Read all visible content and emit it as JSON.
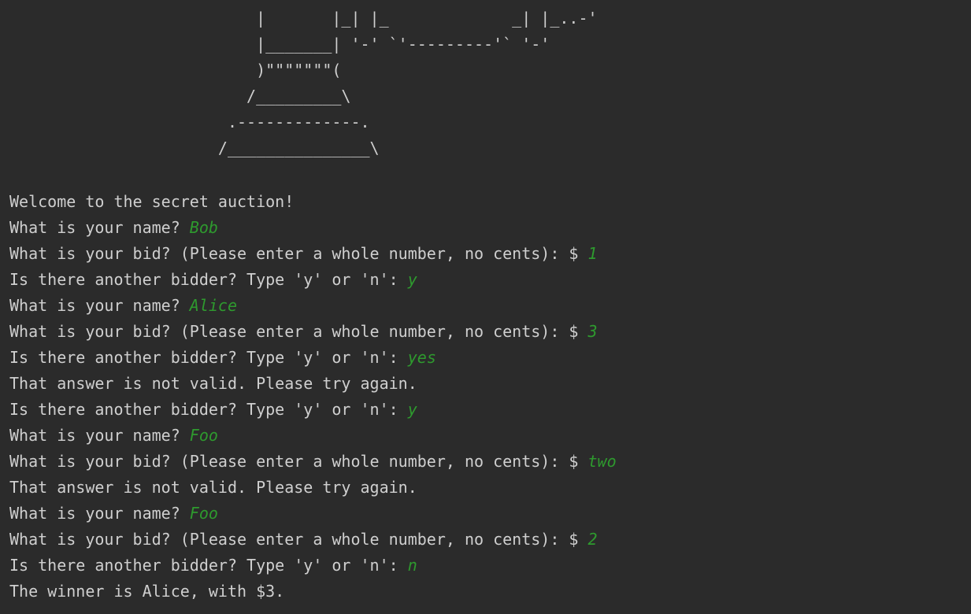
{
  "ascii_art": [
    "                          |       |_| |_             _| |_..-'",
    "                          |_______| '-' `'---------'` '-'",
    "                          )\"\"\"\"\"\"\"(",
    "                         /_________\\",
    "                       .-------------.",
    "                      /_______________\\"
  ],
  "session": [
    {
      "text": "Welcome to the secret auction!",
      "input": ""
    },
    {
      "text": "What is your name? ",
      "input": "Bob"
    },
    {
      "text": "What is your bid? (Please enter a whole number, no cents): $ ",
      "input": "1"
    },
    {
      "text": "Is there another bidder? Type 'y' or 'n': ",
      "input": "y"
    },
    {
      "text": "What is your name? ",
      "input": "Alice"
    },
    {
      "text": "What is your bid? (Please enter a whole number, no cents): $ ",
      "input": "3"
    },
    {
      "text": "Is there another bidder? Type 'y' or 'n': ",
      "input": "yes"
    },
    {
      "text": "That answer is not valid. Please try again.",
      "input": ""
    },
    {
      "text": "Is there another bidder? Type 'y' or 'n': ",
      "input": "y"
    },
    {
      "text": "What is your name? ",
      "input": "Foo"
    },
    {
      "text": "What is your bid? (Please enter a whole number, no cents): $ ",
      "input": "two"
    },
    {
      "text": "That answer is not valid. Please try again.",
      "input": ""
    },
    {
      "text": "What is your name? ",
      "input": "Foo"
    },
    {
      "text": "What is your bid? (Please enter a whole number, no cents): $ ",
      "input": "2"
    },
    {
      "text": "Is there another bidder? Type 'y' or 'n': ",
      "input": "n"
    },
    {
      "text": "The winner is Alice, with $3.",
      "input": ""
    }
  ]
}
